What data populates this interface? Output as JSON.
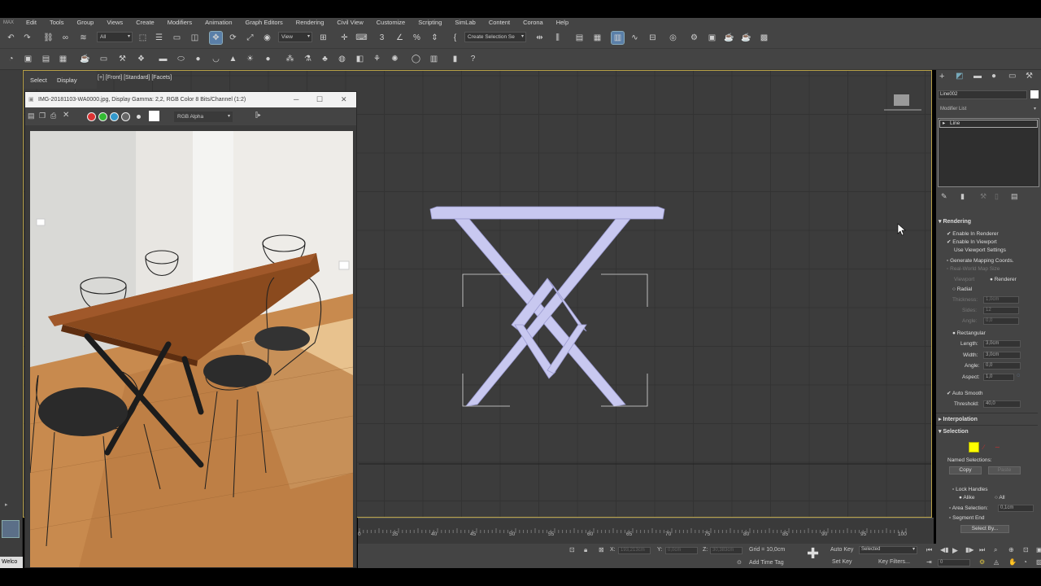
{
  "menu": {
    "logo": "MAX",
    "items": [
      "Edit",
      "Tools",
      "Group",
      "Views",
      "Create",
      "Modifiers",
      "Animation",
      "Graph Editors",
      "Rendering",
      "Civil View",
      "Customize",
      "Scripting",
      "SimLab",
      "Content",
      "Corona",
      "Help"
    ]
  },
  "toolbar": {
    "filter_value": "All",
    "view_value": "View",
    "selection_set_value": "Create Selection Se"
  },
  "scene_explorer": {
    "select_tab": "Select",
    "display_tab": "Display"
  },
  "viewport": {
    "label": "[+] [Front] [Standard] [Facets]"
  },
  "image_window": {
    "title": "IMG-20181103-WA0000.jpg, Display Gamma: 2,2, RGB Color 8 Bits/Channel (1:2)",
    "channel_value": "RGB Alpha"
  },
  "command_panel": {
    "object_name": "Line002",
    "modifier_list": "Modifier List",
    "stack_item": "Line",
    "rendering": {
      "title": "Rendering",
      "enable_in_renderer": "Enable In Renderer",
      "enable_in_viewport": "Enable In Viewport",
      "use_viewport_settings": "Use Viewport Settings",
      "generate_mapping": "Generate Mapping Coords.",
      "real_world_map": "Real-World Map Size",
      "viewport_radio": "Viewport",
      "renderer_radio": "Renderer",
      "radial": "Radial",
      "thickness_label": "Thickness:",
      "thickness_value": "1,0cm",
      "sides_label": "Sides:",
      "sides_value": "12",
      "angle_label": "Angle:",
      "angle_value": "0,0",
      "rectangular": "Rectangular",
      "length_label": "Length:",
      "length_value": "3,0cm",
      "width_label": "Width:",
      "width_value": "3,0cm",
      "rect_angle_label": "Angle:",
      "rect_angle_value": "0,0",
      "aspect_label": "Aspect:",
      "aspect_value": "1,0",
      "auto_smooth": "Auto Smooth",
      "threshold_label": "Threshold:",
      "threshold_value": "40,0"
    },
    "interpolation_title": "Interpolation",
    "selection": {
      "title": "Selection",
      "named_selections": "Named Selections:",
      "copy": "Copy",
      "paste": "Paste",
      "lock_handles": "Lock Handles",
      "alike": "Alike",
      "all": "All",
      "area_selection_label": "Area Selection:",
      "area_selection_value": "0,1cm",
      "segment_end": "Segment End",
      "select_by": "Select By..."
    }
  },
  "timeline": {
    "ticks": [
      "0",
      "35",
      "40",
      "45",
      "50",
      "55",
      "60",
      "65",
      "70",
      "75",
      "80",
      "85",
      "90",
      "95",
      "100"
    ]
  },
  "status": {
    "x_label": "X:",
    "x_value": "193,213cm",
    "y_label": "Y:",
    "y_value": "0,0cm",
    "z_label": "Z:",
    "z_value": "30,383cm",
    "grid": "Grid = 10,0cm",
    "add_time_tag": "Add Time Tag",
    "auto_key": "Auto Key",
    "set_key": "Set Key",
    "key_mode_value": "Selected",
    "key_filters": "Key Filters...",
    "frame_value": "0",
    "welcome": "Welco"
  },
  "colors": {
    "viewport_border": "#b7a047",
    "shape_fill": "#c8c8f0",
    "active_tool": "#5a7fa8"
  }
}
